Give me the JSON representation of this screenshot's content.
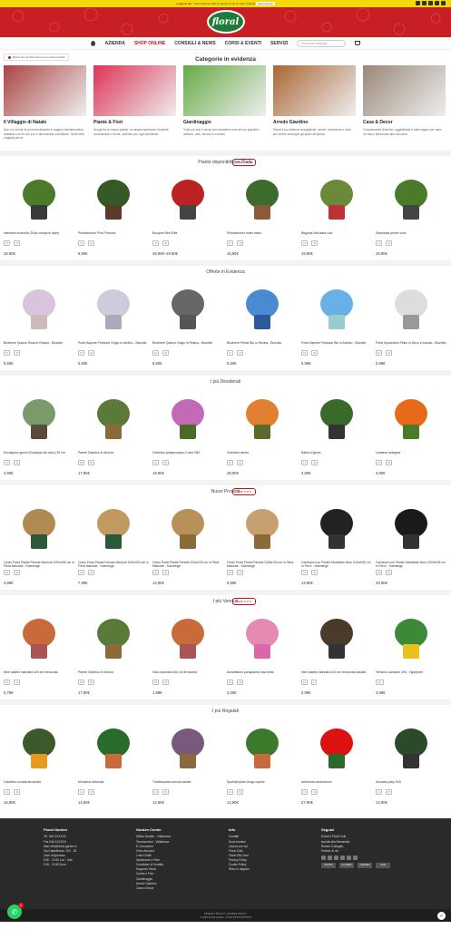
{
  "topbar": {
    "message_link": "Leggi di più",
    "message": "Puoi ricevere 10% di sconto in più su tutti i prodotti",
    "badge": "Scopri di più"
  },
  "logo": "floral",
  "nav": {
    "items": [
      "AZIENDA",
      "SHOP ONLINE",
      "CONSIGLI & NEWS",
      "CORSI & EVENTI",
      "SERVIZI"
    ],
    "search_placeholder": "Cerca nel catalogo"
  },
  "notice": "Ricevi fino al 10% sconto nei nostri prodotti",
  "categories": {
    "title": "Categorie in evidenza",
    "items": [
      {
        "title": "Il Villaggio di Natale",
        "desc": "Non c'è niente di più emozionante e magico dell'atmosfera natalizia con le sue luci e decorazioni scintillanti. Tante idee originali per te",
        "color": "#a44"
      },
      {
        "title": "Piante & Fiori",
        "desc": "Scegli fra le nostre piante, un'ampia selezione di piante ornamentali e fiorite, perfette per ogni ambiente",
        "color": "#d35"
      },
      {
        "title": "Giardinaggio",
        "desc": "Tutto ciò che ti serve per prenderti cura del tuo giardino: attrezzi, vasi, terricci e concimi",
        "color": "#6a4"
      },
      {
        "title": "Arredo Giardino",
        "desc": "Rendi il tuo esterno accogliente: arredi, ombrelloni e tutto per vivere al meglio gli spazi all'aperto",
        "color": "#a63"
      },
      {
        "title": "Casa & Decor",
        "desc": "Complementi d'arredo, oggettistica e idee regalo per dare un tocco personale alla tua casa",
        "color": "#987"
      }
    ]
  },
  "sections": [
    {
      "title": "Piante disponibili per l'Italia",
      "vedi": "VEDI TUTTI",
      "items": [
        {
          "name": "Hanneke bromelia (Tilcie campa di lapin)",
          "meta": [
            "15",
            "70"
          ],
          "price": "16,90€",
          "c1": "#4a7a2a",
          "c2": "#3a3a3a"
        },
        {
          "name": "Philodendron Pink Princess",
          "meta": [
            "12",
            "40"
          ],
          "price": "6,90€",
          "c1": "#355a25",
          "c2": "#5a3a2a"
        },
        {
          "name": "Bouquet Red Elite",
          "meta": [
            "35",
            "50"
          ],
          "price": "49,90€–29,90€",
          "c1": "#b22",
          "c2": "#444"
        },
        {
          "name": "Philodendron birkin stella",
          "meta": [
            "14",
            "45"
          ],
          "price": "16,90€",
          "c1": "#3d6a2d",
          "c2": "#8a5a3a"
        },
        {
          "name": "Begonia Maculata cuor",
          "meta": [
            "12",
            "35"
          ],
          "price": "19,90€",
          "c1": "#6a8a3a",
          "c2": "#b33"
        },
        {
          "name": "Stephania pierrei vivid",
          "meta": [
            "14",
            "40"
          ],
          "price": "29,90€",
          "c1": "#4a7a2a",
          "c2": "#444"
        }
      ]
    },
    {
      "title": "Offerte in Evidenza",
      "vedi": "",
      "items": [
        {
          "name": "Bicchiere Quarzo Rosa in Resina - Bizzotto",
          "meta": [
            "10",
            "20"
          ],
          "price": "5,50€",
          "c1": "#d9c3dd",
          "c2": "#cbb"
        },
        {
          "name": "Porta Sapone Prestone Grigio in Acrilico - Bizzotto",
          "meta": [
            "10",
            "20"
          ],
          "price": "5,50€",
          "c1": "#ccd",
          "c2": "#aab"
        },
        {
          "name": "Bicchiere Quarzo Grigio in Resina - Bizzotto",
          "meta": [
            "10",
            "20"
          ],
          "price": "5,50€",
          "c1": "#666",
          "c2": "#555"
        },
        {
          "name": "Bicchiere Pesce Blu in Resina - Bizzotto",
          "meta": [
            "10",
            "20"
          ],
          "price": "5,50€",
          "c1": "#4a8ad0",
          "c2": "#2a5a9a"
        },
        {
          "name": "Porta Sapone Prestone Blu in Acrilico - Bizzotto",
          "meta": [
            "10",
            "20"
          ],
          "price": "5,99€",
          "c1": "#6ab0e8",
          "c2": "#9cc"
        },
        {
          "name": "Porta Spazzolino Pinko in Zinco e Acciaio - Bizzotto",
          "meta": [
            "10",
            "20"
          ],
          "price": "5,99€",
          "c1": "#ddd",
          "c2": "#999"
        }
      ]
    },
    {
      "title": "I più Desiderati",
      "vedi": "",
      "items": [
        {
          "name": "Eucalyptus gunnii (Eucalipto del sidro) 30 cm",
          "meta": [
            "14",
            "40"
          ],
          "price": "4,90€",
          "c1": "#7a9a6a",
          "c2": "#5a4a3a"
        },
        {
          "name": "Parete Giardino in Alveolo",
          "meta": [
            "30",
            "80"
          ],
          "price": "17,90€",
          "c1": "#5a7a3a",
          "c2": "#8a6a3a"
        },
        {
          "name": "Orchidea phalaenopsis 2 rami H60",
          "meta": [
            "12",
            "60"
          ],
          "price": "19,90€",
          "c1": "#c36ab6",
          "c2": "#4a6a2a"
        },
        {
          "name": "Orchidea vanda",
          "meta": [
            "12",
            "50"
          ],
          "price": "49,90€",
          "c1": "#e08030",
          "c2": "#5a6a2a"
        },
        {
          "name": "Batha di glove",
          "meta": [
            "14",
            "40"
          ],
          "price": "3,90€",
          "c1": "#3a6a2a",
          "c2": "#333"
        },
        {
          "name": "Lantana variegata",
          "meta": [
            "14",
            "35"
          ],
          "price": "3,90€",
          "c1": "#e66a1a",
          "c2": "#4a7a2a"
        }
      ]
    },
    {
      "title": "Nuovi Prodotti",
      "vedi": "VEDI TUTTI",
      "items": [
        {
          "name": "Cesto Porta Piante Pensile Bicolore D20xH30 cm in Fibra Naturale - Kaemingk",
          "meta": [
            "20",
            "30"
          ],
          "price": "3,99€",
          "c1": "#b08a50",
          "c2": "#2a5a3a"
        },
        {
          "name": "Cesto Porta Piante Pensile Bicolore D20xH33 cm in Fibra Naturale - Kaemingk",
          "meta": [
            "20",
            "33"
          ],
          "price": "7,99€",
          "c1": "#c09a60",
          "c2": "#2a5a3a"
        },
        {
          "name": "Cesto Porta Piante Pensile D20xH30 cm in Fibra Naturale - Kaemingk",
          "meta": [
            "20",
            "30"
          ],
          "price": "14,90€",
          "c1": "#b8905a",
          "c2": "#8a6a3a"
        },
        {
          "name": "Cesto Porta Piante Pensile D25xH33 cm in Fibra Naturale - Kaemingk",
          "meta": [
            "25",
            "33"
          ],
          "price": "9,99€",
          "c1": "#c8a070",
          "c2": "#8a6a3a"
        },
        {
          "name": "Cachepot con Piedini Martellato Nero D15xH20 cm in Ferro - Kaemingk",
          "meta": [
            "15",
            "20"
          ],
          "price": "14,90€",
          "c1": "#222",
          "c2": "#333"
        },
        {
          "name": "Cachepot con Piedini Martellato Nero D20xH25 cm in Ferro - Kaemingk",
          "meta": [
            "20",
            "25"
          ],
          "price": "29,90€",
          "c1": "#1a1a1a",
          "c2": "#333"
        }
      ]
    },
    {
      "title": "I più Venduti",
      "vedi": "VEDI TUTTI",
      "items": [
        {
          "name": "Mini vasetto standard d15 cm terracotta",
          "meta": [
            "15",
            "13"
          ],
          "price": "0,75€",
          "c1": "#c96a3a",
          "c2": "#a55"
        },
        {
          "name": "Parete Giardino in Alveolo",
          "meta": [
            "30",
            "80"
          ],
          "price": "17,90€",
          "c1": "#5a7a3a",
          "c2": "#8a6a3a"
        },
        {
          "name": "Vaso standard d15 cm terracotta",
          "meta": [
            "15",
            "13"
          ],
          "price": "1,99€",
          "c1": "#c96a3a",
          "c2": "#a55"
        },
        {
          "name": "Annaffiatoio portapianta rosa bella",
          "meta": [
            "20",
            "25"
          ],
          "price": "2,50€",
          "c1": "#e58ab0",
          "c2": "#d6a"
        },
        {
          "name": "Mini vasetto standard d10 cm terracotta basalto",
          "meta": [
            "10",
            "9"
          ],
          "price": "0,99€",
          "c1": "#4a3a2a",
          "c2": "#333"
        },
        {
          "name": "Terriccio cactacee 20lt - Vigorplant",
          "meta": [
            "20L",
            ""
          ],
          "price": "4,99€",
          "c1": "#3a8a3a",
          "c2": "#e8c020"
        }
      ]
    },
    {
      "title": "I più Regalati",
      "vedi": "",
      "items": [
        {
          "name": "Calathea crocata terracotta",
          "meta": [
            "14",
            "40"
          ],
          "price": "16,90€",
          "c1": "#3a5a2a",
          "c2": "#e89a20"
        },
        {
          "name": "Monstera deliciosa",
          "meta": [
            "14",
            "45"
          ],
          "price": "14,90€",
          "c1": "#2a6a2a",
          "c2": "#c96a3a"
        },
        {
          "name": "Tradescantia nanouk basket",
          "meta": [
            "14",
            "30"
          ],
          "price": "12,90€",
          "c1": "#7a5a7a",
          "c2": "#8a6a3a"
        },
        {
          "name": "Spathiphyllum bingo cupido",
          "meta": [
            "14",
            "50"
          ],
          "price": "14,90€",
          "c1": "#3a7a2a",
          "c2": "#c96a3a"
        },
        {
          "name": "Anthurium andreanum",
          "meta": [
            "14",
            "45"
          ],
          "price": "27,90€",
          "c1": "#d11",
          "c2": "#2a6a2a"
        },
        {
          "name": "Alocasia polly H45",
          "meta": [
            "14",
            "45"
          ],
          "price": "14,90€",
          "c1": "#2a4a2a",
          "c2": "#333"
        }
      ]
    }
  ],
  "footer": {
    "col1": {
      "title": "Floral Garden",
      "lines": [
        "Tel. 045 XXXXXX",
        "Fax 045 XXXXXX",
        "Mail: info@floral-garden.it",
        "Via Castelfranco 100 - 18",
        "Orari di Apertura",
        "8:30 - 19:30 Lun - Sab",
        "9:00 - 19:30 Dom"
      ]
    },
    "col2": {
      "title": "Garden Center",
      "lines": [
        "Ufficio Garden - Villafranca",
        "Tecnoservice - Villafranca",
        "E-Commerce",
        "Il mio Account",
        "I miei Ordini",
        "Spedizione e Resi",
        "Condizioni di Vendita",
        "Supporto Floral",
        "Centro e Fiori",
        "Giardinaggio",
        "Arredo Giardino",
        "Casa e Decor"
      ]
    },
    "col3": {
      "title": "Info",
      "lines": [
        "Contatti",
        "Dove trovarci",
        "Lavora con noi",
        "Floral Club",
        "Floral Gift Card",
        "Privacy Policy",
        "Cookie Policy",
        "Ritiro in negozio"
      ]
    },
    "col4": {
      "title": "Seguici",
      "lines": [
        "Entra in Floral Club",
        "Iscriviti alla Newsletter",
        "Rimani Collegato",
        "Partner di noi"
      ],
      "partners": [
        "PIANTA",
        "FLOWER",
        "GARDEN",
        "LIVE"
      ]
    },
    "bottom": [
      "PRIVACY POLICY | COOKIE POLICY",
      "© 2022 Floral Garden - P.IVA XXXXXXXXXXX"
    ]
  },
  "whatsapp_badge": "1"
}
